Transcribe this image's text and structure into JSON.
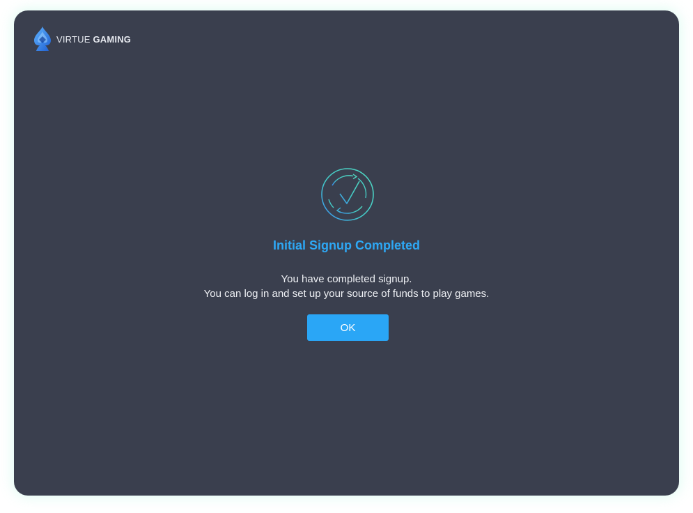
{
  "brand": {
    "name_light": "VIRTUE ",
    "name_bold": "GAMING",
    "logo_icon": "spade-logo-icon"
  },
  "dialog": {
    "status_icon": "check-circle-icon",
    "title": "Initial Signup Completed",
    "message_line1": "You have completed signup.",
    "message_line2": "You can log in and set up your source of funds to play games.",
    "ok_label": "OK"
  },
  "colors": {
    "window_bg": "#3a3f4e",
    "accent": "#2aa6f6",
    "title": "#2ea8f5",
    "icon_teal": "#4fd6c0",
    "icon_blue": "#3a8cf0"
  }
}
